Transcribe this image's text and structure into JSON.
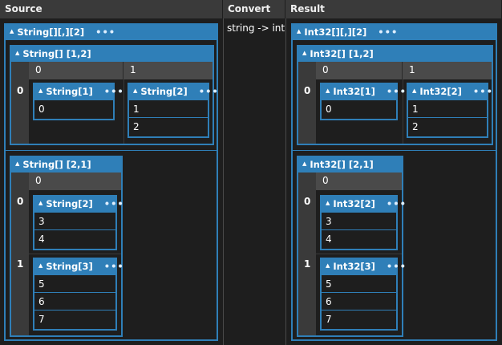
{
  "columns": {
    "source": "Source",
    "convert": "Convert",
    "result": "Result"
  },
  "convert_text": "string -> int",
  "source": {
    "title": "String[][,][2]",
    "g1": {
      "title": "String[] [1,2]",
      "h0": "0",
      "h1": "1",
      "r0": "0",
      "a": {
        "title": "String[1]",
        "items": [
          "0"
        ]
      },
      "b": {
        "title": "String[2]",
        "items": [
          "1",
          "2"
        ]
      }
    },
    "g2": {
      "title": "String[] [2,1]",
      "h0": "0",
      "r0": "0",
      "r1": "1",
      "a": {
        "title": "String[2]",
        "items": [
          "3",
          "4"
        ]
      },
      "b": {
        "title": "String[3]",
        "items": [
          "5",
          "6",
          "7"
        ]
      }
    }
  },
  "result": {
    "title": "Int32[][,][2]",
    "g1": {
      "title": "Int32[] [1,2]",
      "h0": "0",
      "h1": "1",
      "r0": "0",
      "a": {
        "title": "Int32[1]",
        "items": [
          "0"
        ]
      },
      "b": {
        "title": "Int32[2]",
        "items": [
          "1",
          "2"
        ]
      }
    },
    "g2": {
      "title": "Int32[] [2,1]",
      "h0": "0",
      "r0": "0",
      "r1": "1",
      "a": {
        "title": "Int32[2]",
        "items": [
          "3",
          "4"
        ]
      },
      "b": {
        "title": "Int32[3]",
        "items": [
          "5",
          "6",
          "7"
        ]
      }
    }
  },
  "icons": {
    "collapse": "triangle-up-icon",
    "more": "ellipsis-icon"
  }
}
